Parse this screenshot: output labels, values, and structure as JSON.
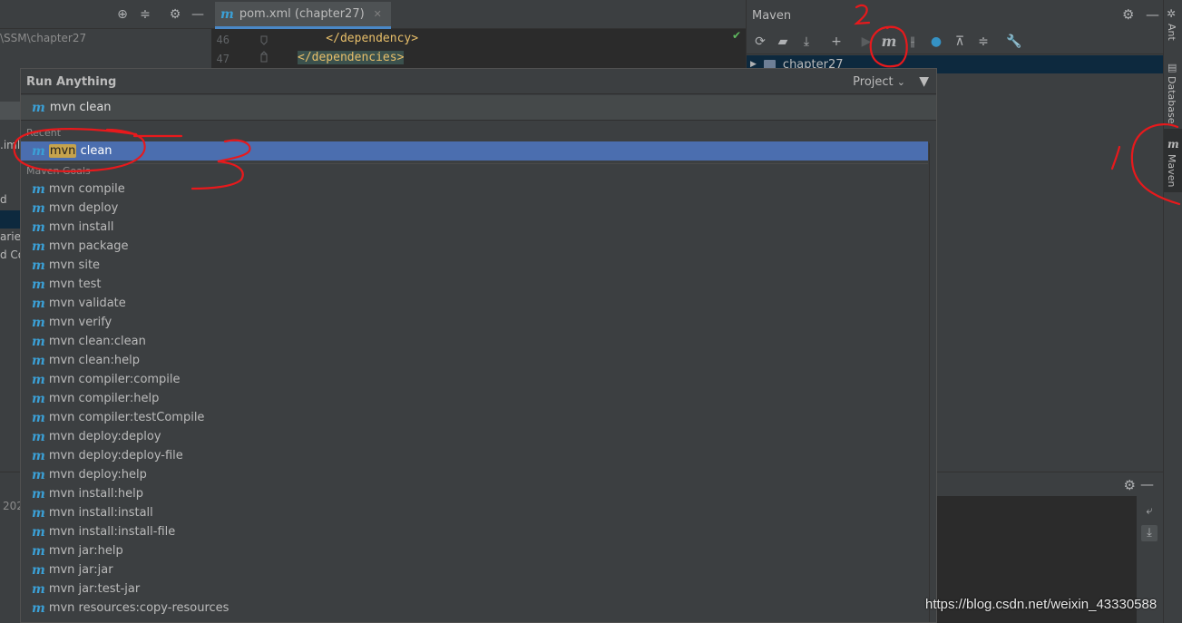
{
  "left_panel": {
    "path": "\\SSM\\chapter27",
    "fragments": [
      {
        "text": ".iml"
      },
      {
        "text": "d"
      },
      {
        "text": "aries"
      },
      {
        "text": "d Co"
      }
    ],
    "bottom_date": "202"
  },
  "editor": {
    "tab": {
      "icon": "m",
      "label": "pom.xml (chapter27)",
      "close": "✕"
    },
    "lines": [
      {
        "num": "46",
        "code": "    </dependency>"
      },
      {
        "num": "47",
        "code": "</dependencies>"
      }
    ]
  },
  "maven": {
    "title": "Maven",
    "tree_item": "chapter27"
  },
  "right_stripe": {
    "items": [
      "Ant",
      "Database",
      "Maven"
    ]
  },
  "run_anything": {
    "title": "Run Anything",
    "scope": "Project",
    "scope_chevron": "⌄",
    "search_value": "mvn clean",
    "recent_header": "Recent",
    "recent_item": {
      "highlight": "mvn",
      "rest": " clean"
    },
    "goals_header": "Maven Goals",
    "goals": [
      "mvn compile",
      "mvn deploy",
      "mvn install",
      "mvn package",
      "mvn site",
      "mvn test",
      "mvn validate",
      "mvn verify",
      "mvn clean:clean",
      "mvn clean:help",
      "mvn compiler:compile",
      "mvn compiler:help",
      "mvn compiler:testCompile",
      "mvn deploy:deploy",
      "mvn deploy:deploy-file",
      "mvn deploy:help",
      "mvn install:help",
      "mvn install:install",
      "mvn install:install-file",
      "mvn jar:help",
      "mvn jar:jar",
      "mvn jar:test-jar",
      "mvn resources:copy-resources"
    ]
  },
  "annotations": {
    "labels": [
      "2",
      "1",
      "3"
    ],
    "color": "#e8191c"
  },
  "watermark": "https://blog.csdn.net/weixin_43330588"
}
